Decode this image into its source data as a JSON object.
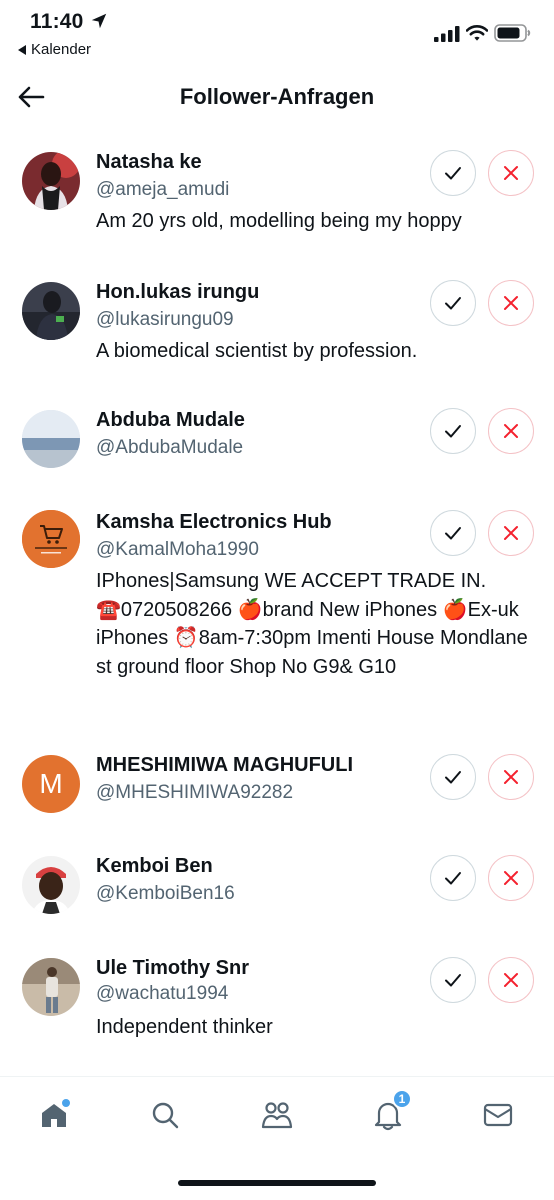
{
  "status_bar": {
    "time": "11:40",
    "back_app": "Kalender"
  },
  "header": {
    "title": "Follower-Anfragen"
  },
  "requests": [
    {
      "name": "Natasha ke",
      "handle": "@ameja_amudi",
      "bio": "Am 20 yrs old, modelling being my hoppy",
      "avatar": "photo"
    },
    {
      "name": "Hon.lukas irungu",
      "handle": "@lukasirungu09",
      "bio": "A biomedical scientist by profession.",
      "avatar": "photo"
    },
    {
      "name": "Abduba Mudale",
      "handle": "@AbdubaMudale",
      "bio": "",
      "avatar": "photo"
    },
    {
      "name": "Kamsha Electronics Hub",
      "handle": "@KamalMoha1990",
      "bio": "IPhones|Samsung WE ACCEPT TRADE IN. ☎️0720508266 🍎brand New iPhones 🍎Ex-uk iPhones ⏰8am-7:30pm Imenti House Mondlane st ground floor Shop No G9& G10",
      "avatar": "logo"
    },
    {
      "name": "MHESHIMIWA MAGHUFULI",
      "handle": "@MHESHIMIWA92282",
      "bio": "",
      "avatar": "initial",
      "avatar_initial": "M",
      "avatar_color": "#e2722f"
    },
    {
      "name": "Kemboi Ben",
      "handle": "@KemboiBen16",
      "bio": "",
      "avatar": "photo"
    },
    {
      "name": "Ule Timothy Snr",
      "handle": "@wachatu1994",
      "bio": "Independent thinker",
      "avatar": "photo"
    }
  ],
  "tab_bar": {
    "items": [
      "home-icon",
      "search-icon",
      "communities-icon",
      "notifications-icon",
      "messages-icon"
    ],
    "notification_badge": "1"
  },
  "colors": {
    "text": "#0f1419",
    "secondary_text": "#536471",
    "decline": "#f4212e",
    "accent": "#4ba3eb"
  }
}
